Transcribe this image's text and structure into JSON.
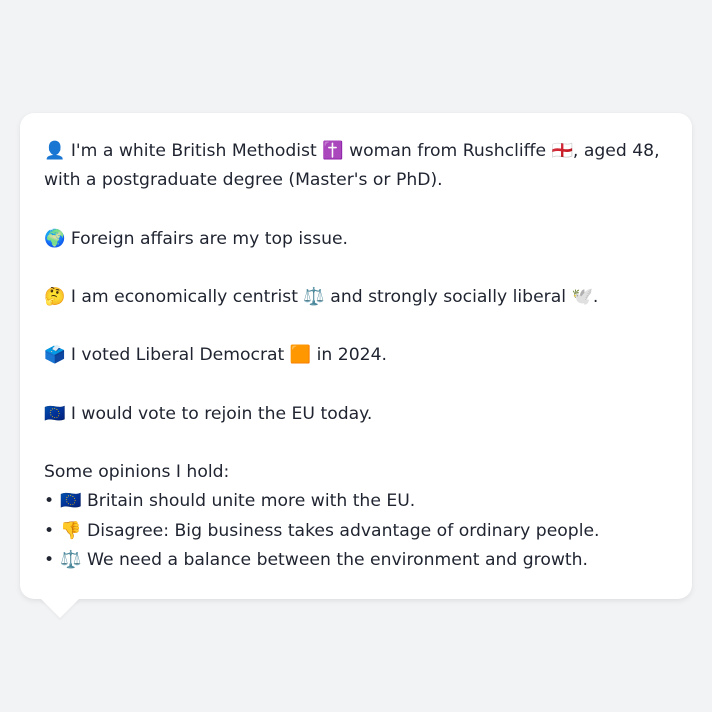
{
  "profile": {
    "intro": "👤 I'm a white British Methodist ✝️ woman from Rushcliffe 🏴󠁧󠁢󠁥󠁮󠁧󠁿, aged 48, with a postgraduate degree (Master's or PhD).",
    "top_issue": "🌍 Foreign affairs are my top issue.",
    "ideology": "🤔 I am economically centrist ⚖️ and strongly socially liberal 🕊️.",
    "vote": "🗳️ I voted Liberal Democrat 🟧 in 2024.",
    "eu": "🇪🇺 I would vote to rejoin the EU today.",
    "opinions_heading": "Some opinions I hold:",
    "opinions": [
      "🇪🇺 Britain should unite more with the EU.",
      "👎 Disagree: Big business takes advantage of ordinary people.",
      "⚖️ We need a balance between the environment and growth."
    ]
  }
}
